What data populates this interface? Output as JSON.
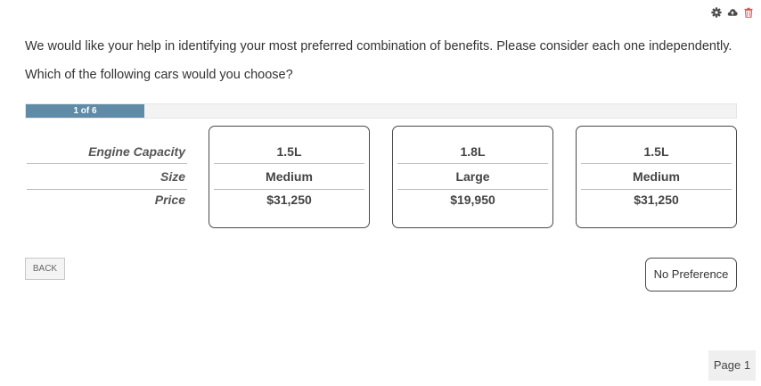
{
  "toolbar": {
    "icons": [
      "gear-icon",
      "cloud-upload-icon",
      "trash-icon"
    ],
    "colors": {
      "gear": "#4a4a4a",
      "cloud": "#4a4a4a",
      "trash": "#d9534f"
    }
  },
  "intro_text": "We would like your help in identifying your most preferred combination of benefits. Please consider each one independently.",
  "question_text": "Which of the following cars would you choose?",
  "progress": {
    "label": "1 of 6",
    "current": 1,
    "total": 6,
    "fill_color": "#5f8ba6"
  },
  "attributes": [
    "Engine Capacity",
    "Size",
    "Price"
  ],
  "options": [
    {
      "engine": "1.5L",
      "size": "Medium",
      "price": "$31,250"
    },
    {
      "engine": "1.8L",
      "size": "Large",
      "price": "$19,950"
    },
    {
      "engine": "1.5L",
      "size": "Medium",
      "price": "$31,250"
    }
  ],
  "buttons": {
    "back": "BACK",
    "no_preference": "No Preference"
  },
  "page_indicator": "Page 1"
}
